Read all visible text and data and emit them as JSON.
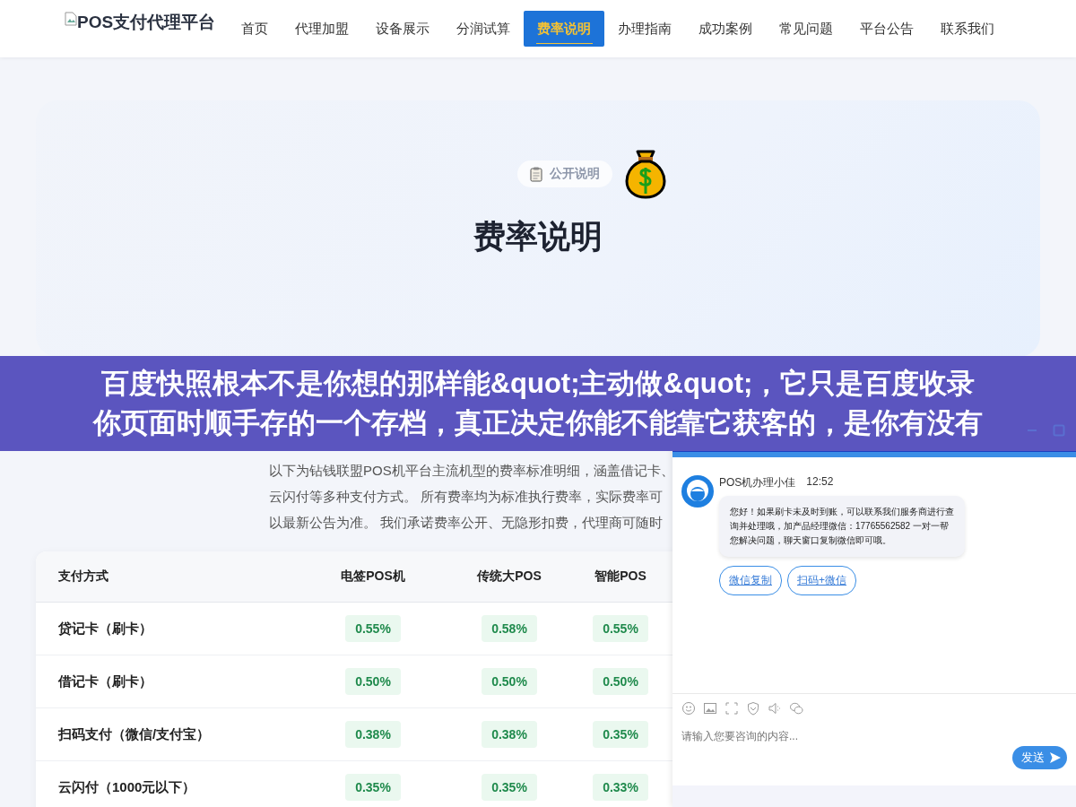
{
  "logo": {
    "text": "POS支付代理平台"
  },
  "nav": [
    {
      "label": "首页",
      "selected": false
    },
    {
      "label": "代理加盟",
      "selected": false
    },
    {
      "label": "设备展示",
      "selected": false
    },
    {
      "label": "分润试算",
      "selected": false
    },
    {
      "label": "费率说明",
      "selected": true
    },
    {
      "label": "办理指南",
      "selected": false
    },
    {
      "label": "成功案例",
      "selected": false
    },
    {
      "label": "常见问题",
      "selected": false
    },
    {
      "label": "平台公告",
      "selected": false
    },
    {
      "label": "联系我们",
      "selected": false
    }
  ],
  "hero": {
    "badge": "公开说明",
    "title": "费率说明"
  },
  "banner": {
    "lines": [
      "百度快照根本不是你想的那样能&quot;主动做&quot;，它只是百度收录",
      "你页面时顺手存的一个存档，真正决定你能不能靠它获客的，是你有没有"
    ]
  },
  "intro": {
    "lines": [
      "以下为钻钱联盟POS机平台主流机型的费率标准明细，涵盖借记卡、",
      "云闪付等多种支付方式。 所有费率均为标准执行费率，实际费率可",
      "以最新公告为准。 我们承诺费率公开、无隐形扣费，代理商可随时"
    ]
  },
  "rate_table": {
    "columns": [
      "支付方式",
      "电签POS机",
      "传统大POS",
      "智能POS"
    ],
    "rows": [
      {
        "method": "贷记卡（刷卡）",
        "rates": [
          "0.55%",
          "0.58%",
          "0.55%"
        ]
      },
      {
        "method": "借记卡（刷卡）",
        "rates": [
          "0.50%",
          "0.50%",
          "0.50%"
        ]
      },
      {
        "method": "扫码支付（微信/支付宝）",
        "rates": [
          "0.38%",
          "0.38%",
          "0.35%"
        ]
      },
      {
        "method": "云闪付（1000元以下）",
        "rates": [
          "0.35%",
          "0.35%",
          "0.33%"
        ]
      }
    ]
  },
  "chat": {
    "agent": "POS机办理小佳",
    "time": "12:52",
    "message": "您好！如果刷卡未及时到账，可以联系我们服务商进行查询并处理哦，加产品经理微信：17765562582 一对一帮您解决问题，聊天窗口复制微信即可哦。",
    "actions": [
      "微信复制",
      "扫码+微信"
    ],
    "input": {
      "placeholder": "请输入您要咨询的内容..."
    },
    "send": "发送"
  }
}
